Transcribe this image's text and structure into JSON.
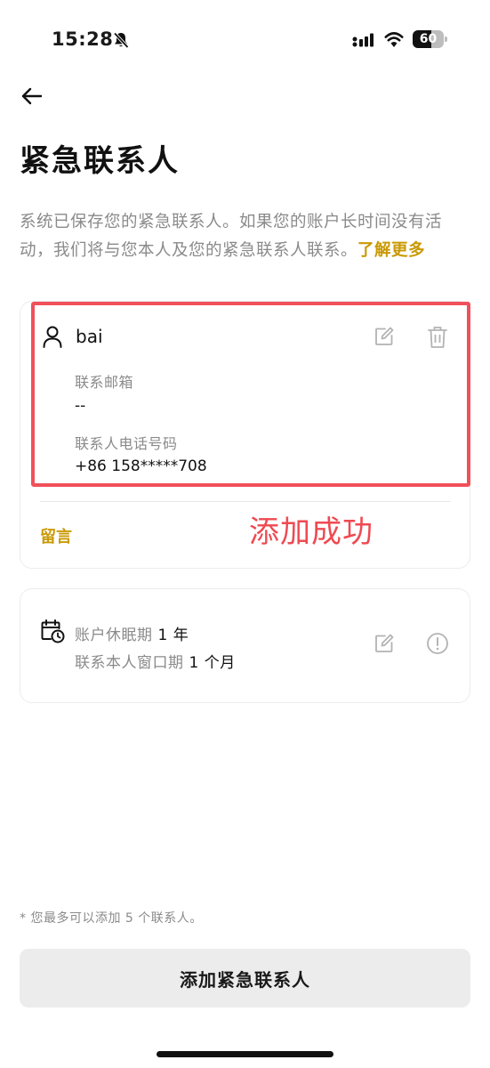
{
  "status_bar": {
    "time": "15:28",
    "battery_level": "60",
    "battery_fraction": 0.6
  },
  "header": {
    "back_icon": "arrow-left-icon",
    "title": "紧急联系人"
  },
  "description": {
    "text": "系统已保存您的紧急联系人。如果您的账户长时间没有活动，我们将与您本人及您的紧急联系人联系。",
    "link_label": "了解更多"
  },
  "contact": {
    "name": "bai",
    "email_label": "联系邮箱",
    "email_value": "--",
    "phone_label": "联系人电话号码",
    "phone_value": "+86 158*****708",
    "message_label": "留言",
    "icons": [
      "person-icon",
      "edit-icon",
      "delete-icon"
    ]
  },
  "annotation": {
    "text": "添加成功",
    "color": "#ee4a52"
  },
  "periods": {
    "dormancy_label": "账户休眠期",
    "dormancy_value": "1 年",
    "window_label": "联系本人窗口期",
    "window_value": "1 个月",
    "icons": [
      "calendar-clock-icon",
      "edit-icon",
      "info-icon"
    ]
  },
  "footer": {
    "note": "* 您最多可以添加 5 个联系人。",
    "add_button_label": "添加紧急联系人"
  },
  "colors": {
    "accent": "#c99a06",
    "highlight": "#f0505a",
    "button_bg": "#ececec"
  }
}
